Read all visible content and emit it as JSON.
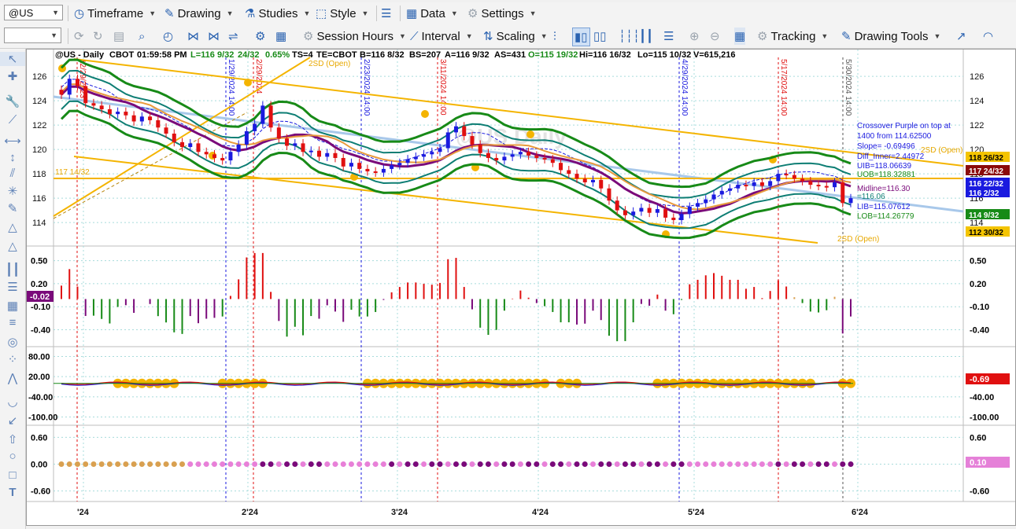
{
  "toolbar1": {
    "symbol_value": "@US",
    "menus": [
      "Timeframe",
      "Drawing",
      "Studies",
      "Style",
      "Data",
      "Settings"
    ]
  },
  "toolbar2": {
    "interval_value": "",
    "menus": [
      "Session Hours",
      "Interval",
      "Scaling",
      "Tracking",
      "Drawing Tools"
    ]
  },
  "header": {
    "symbol": "@US - Daily",
    "exchange": "CBOT",
    "time": "01:59:58 PM",
    "last": "L=116 9/32",
    "change": "24/32",
    "change_pct": "0.65%",
    "ts": "TS=4",
    "te": "TE=CBOT",
    "bid": "B=116 8/32",
    "bid_size": "BS=207",
    "ask": "A=116 9/32",
    "ask_size": "AS=431",
    "open": "O=115 19/32",
    "high": "Hi=116 16/32",
    "low": "Lo=115 10/32",
    "volume": "V=615,216"
  },
  "watermark": "@US Daily",
  "colors": {
    "up": "#1a1adf",
    "down": "#e01010",
    "neutral": "#888888",
    "band_green": "#178a17",
    "band_teal": "#0e7e74",
    "gold": "#f4b400",
    "purple": "#7a0a7a",
    "regression": "#a8c8ea"
  },
  "price_pane": {
    "y_ticks": [
      "126",
      "124",
      "122",
      "120",
      "118",
      "116",
      "114"
    ],
    "ymin": 112.2,
    "ymax": 127.3,
    "annotations": [
      {
        "text": "Crossover Purple on top at",
        "color": "#1a1adf"
      },
      {
        "text": "1400 from 114.62500",
        "color": "#1a1adf"
      },
      {
        "text": "Slope= -0.69496",
        "color": "#1a1adf"
      },
      {
        "text": "Diff_Inner=2.44972",
        "color": "#1a1adf"
      },
      {
        "text": "UIB=118.06639",
        "color": "#1a1adf"
      },
      {
        "text": "UOB=118.32881",
        "color": "#178a17"
      },
      {
        "text": "Midline=116.30",
        "color": "#7a0a7a"
      },
      {
        "text": "=116.06",
        "color": "#0e7e74"
      },
      {
        "text": "LIB=115.07612",
        "color": "#1a1adf"
      },
      {
        "text": "LOB=114.26779",
        "color": "#178a17"
      }
    ],
    "line_labels": [
      "2SD (Open)",
      "2SD (Open)",
      "2SD (Open)",
      "117 14/32"
    ],
    "price_tags": [
      {
        "text": "118 26/32",
        "bg": "#f4c400",
        "fg": "#000"
      },
      {
        "text": "117 24/32",
        "bg": "#8b0a0a",
        "fg": "#fff"
      },
      {
        "text": "116 22/32",
        "bg": "#1a1adf",
        "fg": "#fff"
      },
      {
        "text": "116 2/32",
        "bg": "#1a1adf",
        "fg": "#fff"
      },
      {
        "text": "114 9/32",
        "bg": "#178a17",
        "fg": "#fff"
      },
      {
        "text": "112 30/32",
        "bg": "#f4c400",
        "fg": "#000"
      }
    ],
    "verticals": [
      {
        "text": "12/29/2023",
        "color": "#e01010",
        "x": 64
      },
      {
        "text": "1/29/2024 14:00",
        "color": "#1a1adf",
        "x": 253
      },
      {
        "text": "2/29/2024",
        "color": "#e01010",
        "x": 288
      },
      {
        "text": "2/23/2024 14:00",
        "color": "#1a1adf",
        "x": 425
      },
      {
        "text": "3/11/2024 14:00",
        "color": "#e01010",
        "x": 522
      },
      {
        "text": "4/29/2024 14:00",
        "color": "#1a1adf",
        "x": 829
      },
      {
        "text": "5/17/2024 14:00",
        "color": "#e01010",
        "x": 955
      },
      {
        "text": "5/30/2024 14:00",
        "color": "#555555",
        "x": 1037
      }
    ]
  },
  "osc1": {
    "y_ticks": [
      "0.50",
      "0.20",
      "-0.10",
      "-0.40"
    ],
    "current": "-0.02",
    "right_tags": [
      "0.50",
      "0.20",
      "-0.10",
      "-0.40"
    ]
  },
  "osc2": {
    "y_ticks": [
      "80.00",
      "20.00",
      "-40.00",
      "-100.00"
    ],
    "current": "-0.69",
    "right_tags": [
      "20.00",
      "-40.00",
      "-100.00"
    ]
  },
  "osc3": {
    "y_ticks": [
      "0.60",
      "0.00",
      "-0.60"
    ],
    "current": "0.10",
    "right_tags": [
      "0.60",
      "-0.60"
    ]
  },
  "x_axis": [
    "'24",
    "2'24",
    "3'24",
    "4'24",
    "5'24",
    "6'24"
  ],
  "chart_data": {
    "type": "candlestick",
    "title": "@US - Daily",
    "ylim": [
      112.2,
      127.3
    ],
    "closes": [
      124.5,
      125.8,
      125.2,
      123.8,
      123.6,
      123.3,
      122.9,
      123.1,
      122.8,
      122.3,
      122.7,
      122.4,
      121.8,
      121.3,
      120.6,
      120.2,
      120.5,
      119.8,
      119.6,
      119.3,
      119.1,
      119.8,
      120.4,
      121.5,
      122.1,
      123.6,
      121.8,
      120.9,
      120.3,
      120.5,
      119.8,
      119.9,
      119.4,
      119.7,
      119.3,
      118.6,
      118.9,
      118.4,
      118.2,
      118.1,
      118.4,
      118.7,
      118.9,
      119.2,
      119.4,
      119.6,
      119.8,
      120.1,
      121.4,
      121.9,
      121.1,
      120.4,
      119.7,
      119.3,
      119.1,
      119.4,
      119.6,
      119.8,
      119.5,
      119.3,
      119.2,
      118.9,
      118.3,
      118.0,
      117.6,
      117.3,
      117.5,
      116.8,
      115.8,
      115.0,
      114.6,
      114.9,
      115.2,
      114.8,
      115.1,
      114.4,
      114.2,
      114.7,
      115.3,
      115.6,
      115.9,
      116.3,
      116.6,
      116.8,
      117.1,
      117.0,
      117.3,
      117.0,
      117.4,
      118.0,
      117.9,
      117.6,
      117.4,
      117.1,
      117.0,
      116.9,
      117.3,
      115.6,
      116.0
    ]
  }
}
